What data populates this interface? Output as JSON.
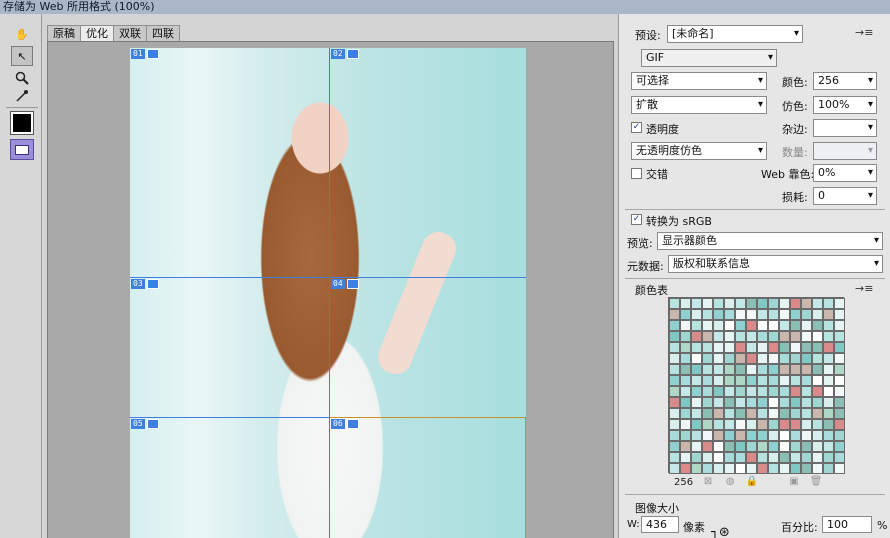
{
  "window": {
    "title": "存储为 Web 所用格式 (100%)"
  },
  "tabs": [
    {
      "label": "原稿",
      "active": false
    },
    {
      "label": "优化",
      "active": true
    },
    {
      "label": "双联",
      "active": false
    },
    {
      "label": "四联",
      "active": false
    }
  ],
  "tools": [
    {
      "name": "hand-tool-icon",
      "glyph": "✋"
    },
    {
      "name": "slice-select-tool-icon",
      "glyph": "↖"
    },
    {
      "name": "zoom-tool-icon",
      "glyph": "🔍"
    },
    {
      "name": "eyedropper-tool-icon",
      "glyph": "✎"
    }
  ],
  "slices": [
    {
      "label": "01"
    },
    {
      "label": "02"
    },
    {
      "label": "03"
    },
    {
      "label": "04"
    },
    {
      "label": "05"
    },
    {
      "label": "06"
    }
  ],
  "settings": {
    "preset_label": "预设:",
    "preset_value": "[未命名]",
    "format_value": "GIF",
    "reduction_value": "可选择",
    "dither_algo_value": "扩散",
    "transparency_label": "透明度",
    "transparency_checked": true,
    "transparency_dither_value": "无透明度仿色",
    "interlaced_label": "交错",
    "interlaced_checked": false,
    "colors_label": "颜色:",
    "colors_value": "256",
    "dither_label": "仿色:",
    "dither_value": "100%",
    "matte_label": "杂边:",
    "matte_value": "",
    "amount_label": "数量:",
    "amount_value": "",
    "web_snap_label": "Web 靠色:",
    "web_snap_value": "0%",
    "lossy_label": "损耗:",
    "lossy_value": "0",
    "convert_srgb_label": "转换为 sRGB",
    "convert_srgb_checked": true,
    "preview_label": "预览:",
    "preview_value": "显示器颜色",
    "metadata_label": "元数据:",
    "metadata_value": "版权和联系信息"
  },
  "color_table": {
    "title": "颜色表",
    "count": "256",
    "palette": [
      "#a8dcdc",
      "#c4e8e8",
      "#8fd0d0",
      "#e6f4f4",
      "#ffffff",
      "#9fd6d2",
      "#b6e2df",
      "#d8efee",
      "#7fc8c4",
      "#c9b7ae",
      "#d98a8a",
      "#aed7c6",
      "#8bbfb5",
      "#f2f8f8"
    ]
  },
  "image_size": {
    "title": "图像大小",
    "w_label": "W:",
    "w_value": "436",
    "w_unit": "像素",
    "percent_label": "百分比:",
    "percent_value": "100",
    "percent_unit": "%"
  }
}
